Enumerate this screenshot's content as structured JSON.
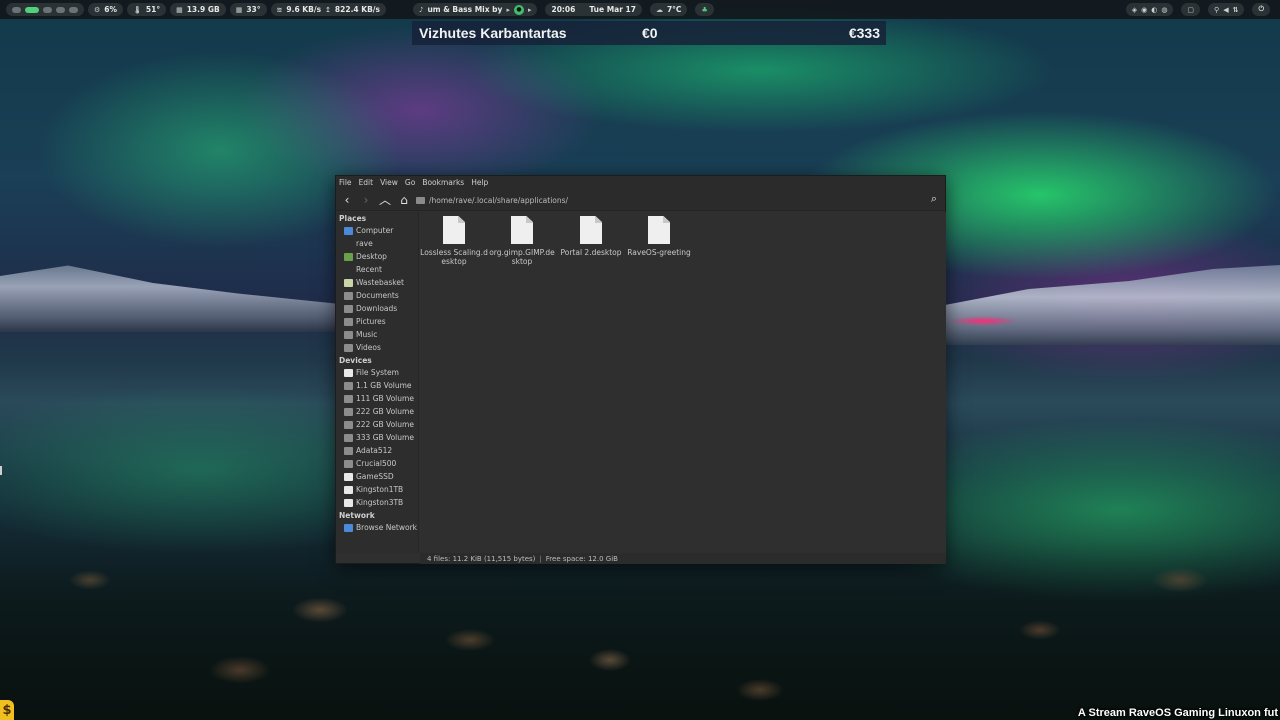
{
  "topbar": {
    "cpu": "6%",
    "temp": "51°",
    "ram": "13.9 GB",
    "gpu_temp": "33°",
    "down_speed": "9.6 KB/s",
    "up_speed": "822.4 KB/s",
    "media": "um & Bass Mix by",
    "time": "20:06",
    "date": "Tue Mar 17",
    "weather": "7°C"
  },
  "price_widget": {
    "name": "Vizhutes Karbantartas",
    "value1": "€0",
    "value2": "€333"
  },
  "file_manager": {
    "menu": [
      "File",
      "Edit",
      "View",
      "Go",
      "Bookmarks",
      "Help"
    ],
    "path": "/home/rave/.local/share/applications/",
    "sidebar": {
      "places_header": "Places",
      "places": [
        "Computer",
        "rave",
        "Desktop",
        "Recent",
        "Wastebasket",
        "Documents",
        "Downloads",
        "Pictures",
        "Music",
        "Videos"
      ],
      "devices_header": "Devices",
      "devices": [
        "File System",
        "1.1 GB Volume",
        "111 GB Volume",
        "222 GB Volume",
        "222 GB Volume",
        "333 GB Volume",
        "Adata512",
        "Crucial500",
        "GameSSD",
        "Kingston1TB",
        "Kingston3TB"
      ],
      "network_header": "Network",
      "network": [
        "Browse Network"
      ]
    },
    "files": [
      {
        "name": "Lossless Scaling.desktop"
      },
      {
        "name": "org.gimp.GIMP.desktop"
      },
      {
        "name": "Portal 2.desktop"
      },
      {
        "name": "RaveOS-greeting"
      }
    ],
    "status": {
      "files": "4 files: 11.2 KiB (11,515 bytes)",
      "free": "Free space: 12.0 GiB"
    }
  },
  "caption": "A Stream RaveOS Gaming Linuxon fut",
  "badge": "$"
}
